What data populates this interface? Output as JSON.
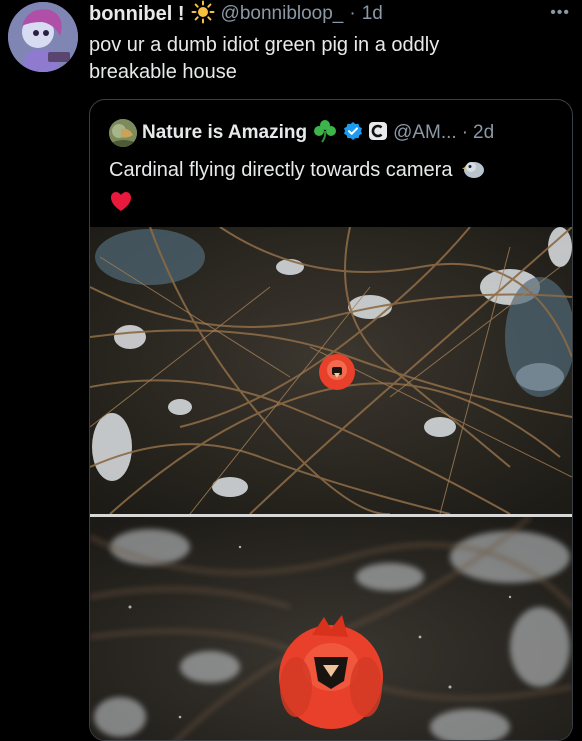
{
  "tweet": {
    "display_name": "bonnibel !",
    "name_emoji": "sun-icon",
    "handle": "@bonnibloop_",
    "separator": "·",
    "time": "1d",
    "text": "pov ur a dumb idiot green pig in a oddly breakable house"
  },
  "quote": {
    "display_name": "Nature is Amazing",
    "name_emoji": "shamrock-icon",
    "badges": [
      "verified-badge-icon",
      "affiliate-badge-icon"
    ],
    "handle": "@AM...",
    "separator": "·",
    "time": "2d",
    "text": "Cardinal flying directly towards camera",
    "text_emojis": [
      "bird-icon",
      "red-heart-icon"
    ]
  },
  "colors": {
    "background": "#000000",
    "text": "#e7e9ea",
    "secondary_text": "#8b98a5",
    "border": "#3a3f44",
    "verified": "#1d9bf0",
    "heart": "#f91880",
    "cardinal": "#e8402a"
  }
}
